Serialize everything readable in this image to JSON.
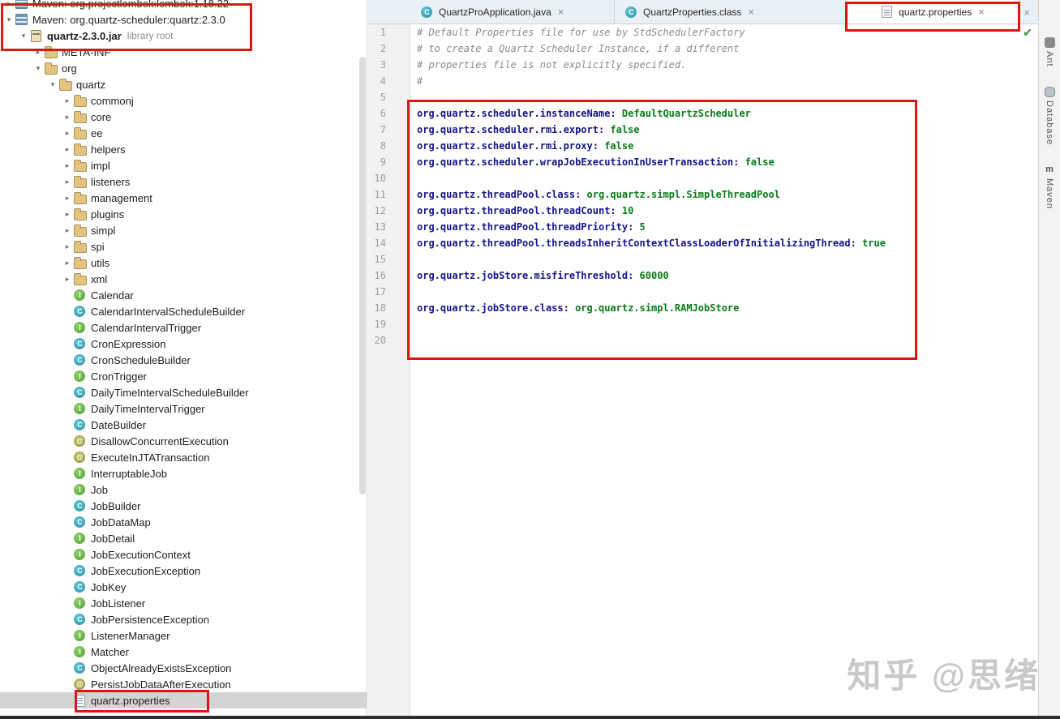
{
  "colors": {
    "annotation_red": "#dd1612",
    "prop_key": "#14148c",
    "prop_value": "#067d17",
    "comment_gray": "#8c8c8c",
    "selection_gray": "#d4d4d4",
    "ok_green": "#4f9e58"
  },
  "watermark": {
    "text": "知乎 @思绪"
  },
  "project_tree": {
    "items": [
      {
        "label": "Maven: org.projectlombok:lombok:1.18.22",
        "icon": "maven-lib",
        "level": 0,
        "chevron": "right"
      },
      {
        "label": "Maven: org.quartz-scheduler:quartz:2.3.0",
        "icon": "maven-lib",
        "level": 0,
        "chevron": "down"
      },
      {
        "label": "quartz-2.3.0.jar",
        "suffix": "library root",
        "icon": "jar",
        "level": 1,
        "chevron": "down",
        "bold": true
      },
      {
        "label": "META-INF",
        "icon": "folder",
        "level": 2,
        "chevron": "right"
      },
      {
        "label": "org",
        "icon": "folder",
        "level": 2,
        "chevron": "down"
      },
      {
        "label": "quartz",
        "icon": "folder",
        "level": 3,
        "chevron": "down"
      },
      {
        "label": "commonj",
        "icon": "folder",
        "level": 4,
        "chevron": "right"
      },
      {
        "label": "core",
        "icon": "folder",
        "level": 4,
        "chevron": "right"
      },
      {
        "label": "ee",
        "icon": "folder",
        "level": 4,
        "chevron": "right"
      },
      {
        "label": "helpers",
        "icon": "folder",
        "level": 4,
        "chevron": "right"
      },
      {
        "label": "impl",
        "icon": "folder",
        "level": 4,
        "chevron": "right"
      },
      {
        "label": "listeners",
        "icon": "folder",
        "level": 4,
        "chevron": "right"
      },
      {
        "label": "management",
        "icon": "folder",
        "level": 4,
        "chevron": "right"
      },
      {
        "label": "plugins",
        "icon": "folder",
        "level": 4,
        "chevron": "right"
      },
      {
        "label": "simpl",
        "icon": "folder",
        "level": 4,
        "chevron": "right"
      },
      {
        "label": "spi",
        "icon": "folder",
        "level": 4,
        "chevron": "right"
      },
      {
        "label": "utils",
        "icon": "folder",
        "level": 4,
        "chevron": "right"
      },
      {
        "label": "xml",
        "icon": "folder",
        "level": 4,
        "chevron": "right"
      },
      {
        "label": "Calendar",
        "icon": "interface",
        "level": 4,
        "chevron": "none"
      },
      {
        "label": "CalendarIntervalScheduleBuilder",
        "icon": "class",
        "level": 4,
        "chevron": "none"
      },
      {
        "label": "CalendarIntervalTrigger",
        "icon": "interface",
        "level": 4,
        "chevron": "none"
      },
      {
        "label": "CronExpression",
        "icon": "class",
        "level": 4,
        "chevron": "none"
      },
      {
        "label": "CronScheduleBuilder",
        "icon": "class",
        "level": 4,
        "chevron": "none"
      },
      {
        "label": "CronTrigger",
        "icon": "interface",
        "level": 4,
        "chevron": "none"
      },
      {
        "label": "DailyTimeIntervalScheduleBuilder",
        "icon": "class",
        "level": 4,
        "chevron": "none"
      },
      {
        "label": "DailyTimeIntervalTrigger",
        "icon": "interface",
        "level": 4,
        "chevron": "none"
      },
      {
        "label": "DateBuilder",
        "icon": "class",
        "level": 4,
        "chevron": "none"
      },
      {
        "label": "DisallowConcurrentExecution",
        "icon": "annotation",
        "level": 4,
        "chevron": "none"
      },
      {
        "label": "ExecuteInJTATransaction",
        "icon": "annotation",
        "level": 4,
        "chevron": "none"
      },
      {
        "label": "InterruptableJob",
        "icon": "interface",
        "level": 4,
        "chevron": "none"
      },
      {
        "label": "Job",
        "icon": "interface",
        "level": 4,
        "chevron": "none"
      },
      {
        "label": "JobBuilder",
        "icon": "class",
        "level": 4,
        "chevron": "none"
      },
      {
        "label": "JobDataMap",
        "icon": "class",
        "level": 4,
        "chevron": "none"
      },
      {
        "label": "JobDetail",
        "icon": "interface",
        "level": 4,
        "chevron": "none"
      },
      {
        "label": "JobExecutionContext",
        "icon": "interface",
        "level": 4,
        "chevron": "none"
      },
      {
        "label": "JobExecutionException",
        "icon": "class",
        "level": 4,
        "chevron": "none"
      },
      {
        "label": "JobKey",
        "icon": "class",
        "level": 4,
        "chevron": "none"
      },
      {
        "label": "JobListener",
        "icon": "interface",
        "level": 4,
        "chevron": "none"
      },
      {
        "label": "JobPersistenceException",
        "icon": "class",
        "level": 4,
        "chevron": "none"
      },
      {
        "label": "ListenerManager",
        "icon": "interface",
        "level": 4,
        "chevron": "none"
      },
      {
        "label": "Matcher",
        "icon": "interface",
        "level": 4,
        "chevron": "none"
      },
      {
        "label": "ObjectAlreadyExistsException",
        "icon": "class",
        "level": 4,
        "chevron": "none"
      },
      {
        "label": "PersistJobDataAfterExecution",
        "icon": "annotation",
        "level": 4,
        "chevron": "none"
      },
      {
        "label": "quartz.properties",
        "icon": "properties",
        "level": 4,
        "chevron": "none",
        "selected": true
      }
    ]
  },
  "editor_tabs": {
    "tabs": [
      {
        "label": "QuartzProApplication.java",
        "icon": "class",
        "close": "×",
        "active": false
      },
      {
        "label": "QuartzProperties.class",
        "icon": "class",
        "close": "×",
        "active": false
      },
      {
        "label": "quartz.properties",
        "icon": "properties",
        "close": "×",
        "active": true
      }
    ],
    "overflow_close": "×"
  },
  "editor": {
    "file_ok_mark": "✔",
    "lines": [
      {
        "n": 1,
        "comment": "# Default Properties file for use by StdSchedulerFactory"
      },
      {
        "n": 2,
        "comment": "# to create a Quartz Scheduler Instance, if a different"
      },
      {
        "n": 3,
        "comment": "# properties file is not explicitly specified."
      },
      {
        "n": 4,
        "comment": "#"
      },
      {
        "n": 5,
        "empty": true
      },
      {
        "n": 6,
        "key": "org.quartz.scheduler.instanceName",
        "value": "DefaultQuartzScheduler"
      },
      {
        "n": 7,
        "key": "org.quartz.scheduler.rmi.export",
        "value": "false"
      },
      {
        "n": 8,
        "key": "org.quartz.scheduler.rmi.proxy",
        "value": "false"
      },
      {
        "n": 9,
        "key": "org.quartz.scheduler.wrapJobExecutionInUserTransaction",
        "value": "false"
      },
      {
        "n": 10,
        "empty": true
      },
      {
        "n": 11,
        "key": "org.quartz.threadPool.class",
        "value": "org.quartz.simpl.SimpleThreadPool"
      },
      {
        "n": 12,
        "key": "org.quartz.threadPool.threadCount",
        "value": "10"
      },
      {
        "n": 13,
        "key": "org.quartz.threadPool.threadPriority",
        "value": "5"
      },
      {
        "n": 14,
        "key": "org.quartz.threadPool.threadsInheritContextClassLoaderOfInitializingThread",
        "value": "true"
      },
      {
        "n": 15,
        "empty": true
      },
      {
        "n": 16,
        "key": "org.quartz.jobStore.misfireThreshold",
        "value": "60000"
      },
      {
        "n": 17,
        "empty": true
      },
      {
        "n": 18,
        "key": "org.quartz.jobStore.class",
        "value": "org.quartz.simpl.RAMJobStore"
      },
      {
        "n": 19,
        "empty": true
      },
      {
        "n": 20,
        "empty": true
      }
    ]
  },
  "tool_stripe": {
    "items": [
      {
        "label": "Ant",
        "icon": "ant-icon"
      },
      {
        "label": "Database",
        "icon": "database-icon"
      },
      {
        "label": "Maven",
        "icon": "maven-icon",
        "glyph": "m"
      }
    ]
  }
}
